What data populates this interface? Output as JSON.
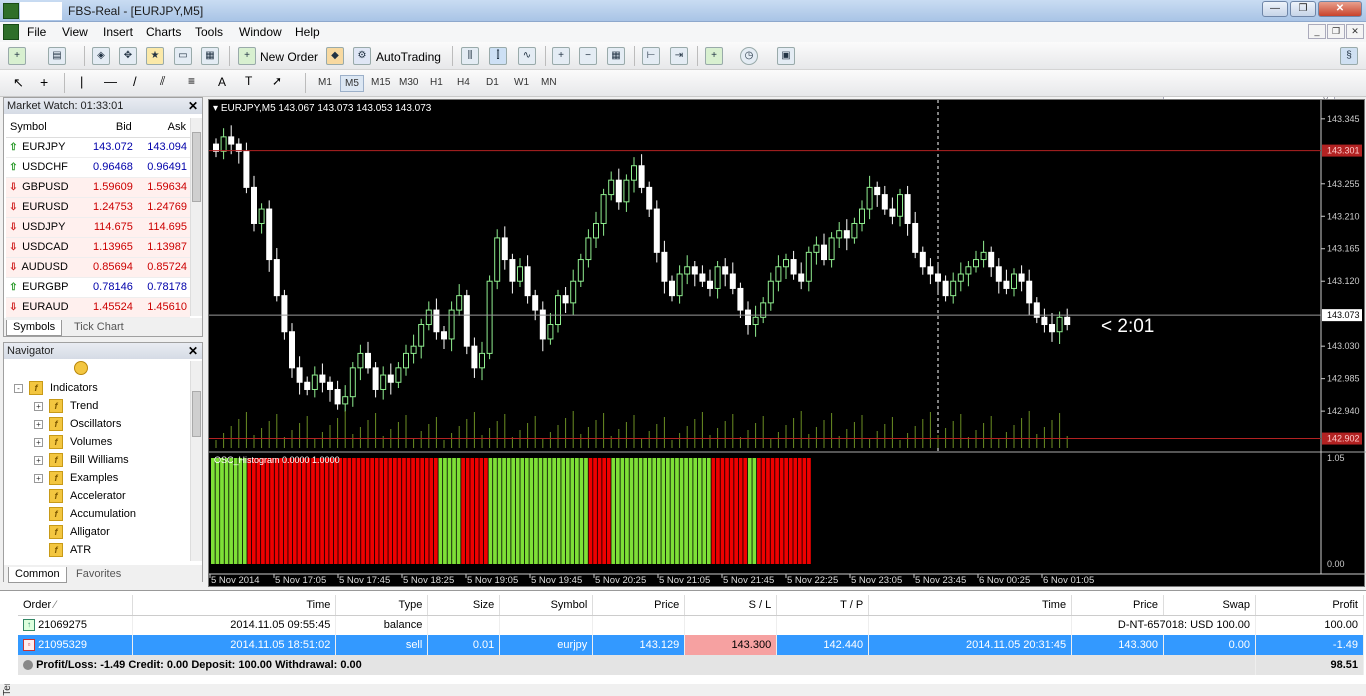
{
  "window": {
    "title": "FBS-Real - [EURJPY,M5]"
  },
  "menu": [
    "File",
    "View",
    "Insert",
    "Charts",
    "Tools",
    "Window",
    "Help"
  ],
  "toolbar": {
    "new_order": "New Order",
    "autotrading": "AutoTrading"
  },
  "timeframes": [
    "M1",
    "M5",
    "M15",
    "M30",
    "H1",
    "H4",
    "D1",
    "W1",
    "MN"
  ],
  "selected_timeframe": "M5",
  "market_watch": {
    "title": "Market Watch: 01:33:01",
    "headers": {
      "symbol": "Symbol",
      "bid": "Bid",
      "ask": "Ask"
    },
    "rows": [
      {
        "symbol": "EURJPY",
        "bid": "143.072",
        "ask": "143.094",
        "dir": "up"
      },
      {
        "symbol": "USDCHF",
        "bid": "0.96468",
        "ask": "0.96491",
        "dir": "up"
      },
      {
        "symbol": "GBPUSD",
        "bid": "1.59609",
        "ask": "1.59634",
        "dir": "down"
      },
      {
        "symbol": "EURUSD",
        "bid": "1.24753",
        "ask": "1.24769",
        "dir": "down"
      },
      {
        "symbol": "USDJPY",
        "bid": "114.675",
        "ask": "114.695",
        "dir": "down"
      },
      {
        "symbol": "USDCAD",
        "bid": "1.13965",
        "ask": "1.13987",
        "dir": "down"
      },
      {
        "symbol": "AUDUSD",
        "bid": "0.85694",
        "ask": "0.85724",
        "dir": "down"
      },
      {
        "symbol": "EURGBP",
        "bid": "0.78146",
        "ask": "0.78178",
        "dir": "up"
      },
      {
        "symbol": "EURAUD",
        "bid": "1.45524",
        "ask": "1.45610",
        "dir": "down"
      }
    ],
    "tabs": [
      "Symbols",
      "Tick Chart"
    ]
  },
  "navigator": {
    "title": "Navigator",
    "items": [
      {
        "label": "Indicators",
        "level": 0,
        "expand": "-"
      },
      {
        "label": "Trend",
        "level": 1,
        "expand": "+"
      },
      {
        "label": "Oscillators",
        "level": 1,
        "expand": "+"
      },
      {
        "label": "Volumes",
        "level": 1,
        "expand": "+"
      },
      {
        "label": "Bill Williams",
        "level": 1,
        "expand": "+"
      },
      {
        "label": "Examples",
        "level": 1,
        "expand": "+"
      },
      {
        "label": "Accelerator",
        "level": 1,
        "expand": ""
      },
      {
        "label": "Accumulation",
        "level": 1,
        "expand": ""
      },
      {
        "label": "Alligator",
        "level": 1,
        "expand": ""
      },
      {
        "label": "ATR",
        "level": 1,
        "expand": ""
      }
    ],
    "tabs": [
      "Common",
      "Favorites"
    ]
  },
  "chart": {
    "header": "EURJPY,M5  143.067 143.073 143.053 143.073",
    "countdown": "< 2:01",
    "indicator_label": "OSC_Histogram 0.0000 1.0000",
    "price_ticks": [
      "143.345",
      "143.255",
      "143.210",
      "143.165",
      "143.120",
      "143.030",
      "142.985",
      "142.940"
    ],
    "sl_price": "143.301",
    "current_price": "143.073",
    "tp_price": "142.902",
    "indicator_ticks": [
      "1.05",
      "0.00"
    ],
    "time_labels": [
      "5 Nov 2014",
      "5 Nov 17:05",
      "5 Nov 17:45",
      "5 Nov 18:25",
      "5 Nov 19:05",
      "5 Nov 19:45",
      "5 Nov 20:25",
      "5 Nov 21:05",
      "5 Nov 21:45",
      "5 Nov 22:25",
      "5 Nov 23:05",
      "5 Nov 23:45",
      "6 Nov 00:25",
      "6 Nov 01:05"
    ],
    "colors": {
      "bull": "#90ee90",
      "bear": "#ffffff",
      "hist_green": "#7ee037",
      "hist_red": "#ee0000",
      "sl_line": "#b22222"
    },
    "price_min": 142.9,
    "price_max": 143.36
  },
  "chart_data": {
    "type": "candlestick",
    "title": "EURJPY,M5",
    "y_range": [
      142.9,
      143.36
    ],
    "closes": [
      143.3,
      143.32,
      143.31,
      143.3,
      143.25,
      143.2,
      143.22,
      143.15,
      143.1,
      143.05,
      143.0,
      142.98,
      142.97,
      142.99,
      142.98,
      142.97,
      142.95,
      142.96,
      143.0,
      143.02,
      143.0,
      142.97,
      142.99,
      142.98,
      143.0,
      143.02,
      143.03,
      143.06,
      143.08,
      143.05,
      143.04,
      143.08,
      143.1,
      143.03,
      143.0,
      143.02,
      143.12,
      143.18,
      143.15,
      143.12,
      143.14,
      143.1,
      143.08,
      143.04,
      143.06,
      143.1,
      143.09,
      143.12,
      143.15,
      143.18,
      143.2,
      143.24,
      143.26,
      143.23,
      143.26,
      143.28,
      143.25,
      143.22,
      143.16,
      143.12,
      143.1,
      143.13,
      143.14,
      143.13,
      143.12,
      143.11,
      143.14,
      143.13,
      143.11,
      143.08,
      143.06,
      143.07,
      143.09,
      143.12,
      143.14,
      143.15,
      143.13,
      143.12,
      143.16,
      143.17,
      143.15,
      143.18,
      143.19,
      143.18,
      143.2,
      143.22,
      143.25,
      143.24,
      143.22,
      143.21,
      143.24,
      143.2,
      143.16,
      143.14,
      143.13,
      143.12,
      143.1,
      143.12,
      143.13,
      143.14,
      143.15,
      143.16,
      143.14,
      143.12,
      143.11,
      143.13,
      143.12,
      143.09,
      143.07,
      143.06,
      143.05,
      143.07,
      143.06
    ],
    "histogram_states": "GGGGGGGGRRRRRRRRRRRRRRRRRRRRRRRRRRRRRRRRRRRRRRRRRRGGGGGRRRRRRGGGGGGGGGGGGGGGGGGGGGGRRRRRGGGGGGGGGGGGGGGGGGGGGGRRRRRRRRGGRRRRRRRRRRRR"
  },
  "orders": {
    "headers": [
      "Order",
      "Time",
      "Type",
      "Size",
      "Symbol",
      "Price",
      "S / L",
      "T / P",
      "Time",
      "Price",
      "Swap",
      "Profit"
    ],
    "rows": [
      {
        "order": "21069275",
        "time": "2014.11.05 09:55:45",
        "type": "balance",
        "size": "",
        "symbol": "",
        "price": "",
        "sl": "",
        "tp": "",
        "time2": "",
        "price2": "D-NT-657018: USD 100.00",
        "swap": "",
        "profit": "100.00"
      },
      {
        "order": "21095329",
        "time": "2014.11.05 18:51:02",
        "type": "sell",
        "size": "0.01",
        "symbol": "eurjpy",
        "price": "143.129",
        "sl": "143.300",
        "tp": "142.440",
        "time2": "2014.11.05 20:31:45",
        "price2": "143.300",
        "swap": "0.00",
        "profit": "-1.49"
      }
    ],
    "summary": "Profit/Loss: -1.49  Credit: 0.00  Deposit: 100.00  Withdrawal: 0.00",
    "summary_total": "98.51"
  },
  "terminal_label": "Terminal"
}
